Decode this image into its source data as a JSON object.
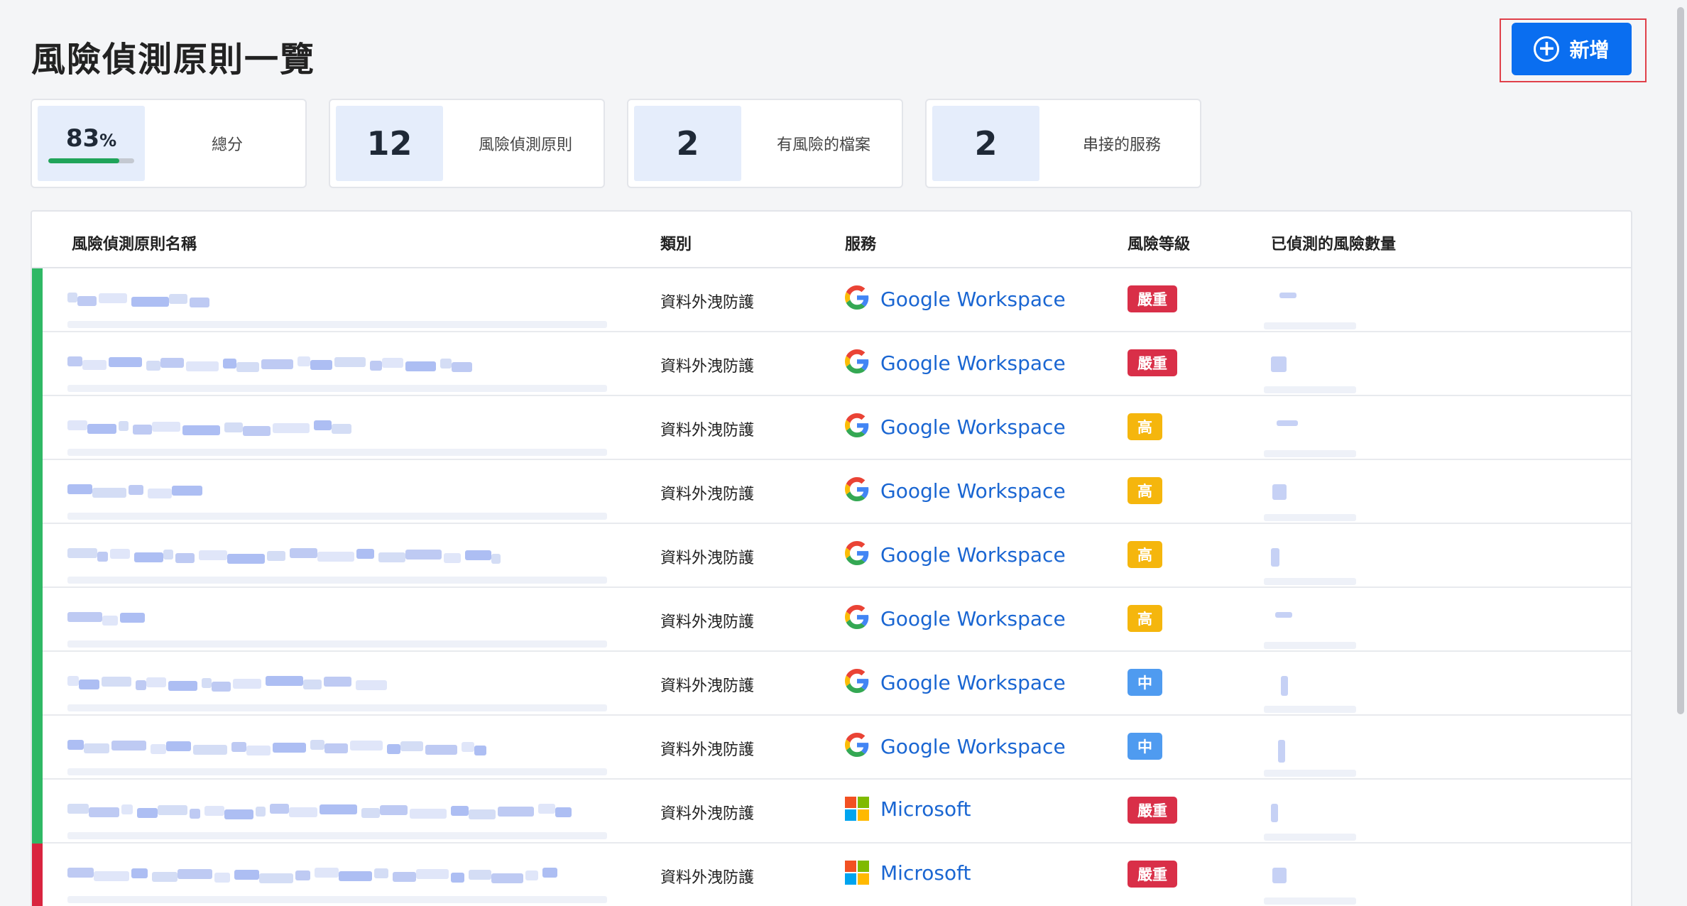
{
  "header": {
    "title": "風險偵測原則一覽",
    "add_label": "新增"
  },
  "stats": [
    {
      "value": "83",
      "unit": "%",
      "label": "總分",
      "progress": 0.83
    },
    {
      "value": "12",
      "label": "風險偵測原則"
    },
    {
      "value": "2",
      "label": "有風險的檔案"
    },
    {
      "value": "2",
      "label": "串接的服務"
    }
  ],
  "table": {
    "columns": [
      "風險偵測原則名稱",
      "類別",
      "服務",
      "風險等級",
      "已偵測的風險數量"
    ],
    "rows": [
      {
        "category": "資料外洩防護",
        "service": "Google Workspace",
        "service_icon": "google-icon",
        "risk": "嚴重",
        "risk_color": "#d92f48",
        "status_color": "#2fb865"
      },
      {
        "category": "資料外洩防護",
        "service": "Google Workspace",
        "service_icon": "google-icon",
        "risk": "嚴重",
        "risk_color": "#d92f48",
        "status_color": "#2fb865"
      },
      {
        "category": "資料外洩防護",
        "service": "Google Workspace",
        "service_icon": "google-icon",
        "risk": "高",
        "risk_color": "#f5b60d",
        "status_color": "#2fb865"
      },
      {
        "category": "資料外洩防護",
        "service": "Google Workspace",
        "service_icon": "google-icon",
        "risk": "高",
        "risk_color": "#f5b60d",
        "status_color": "#2fb865"
      },
      {
        "category": "資料外洩防護",
        "service": "Google Workspace",
        "service_icon": "google-icon",
        "risk": "高",
        "risk_color": "#f5b60d",
        "status_color": "#2fb865"
      },
      {
        "category": "資料外洩防護",
        "service": "Google Workspace",
        "service_icon": "google-icon",
        "risk": "高",
        "risk_color": "#f5b60d",
        "status_color": "#2fb865"
      },
      {
        "category": "資料外洩防護",
        "service": "Google Workspace",
        "service_icon": "google-icon",
        "risk": "中",
        "risk_color": "#4f9bf0",
        "status_color": "#2fb865"
      },
      {
        "category": "資料外洩防護",
        "service": "Google Workspace",
        "service_icon": "google-icon",
        "risk": "中",
        "risk_color": "#4f9bf0",
        "status_color": "#2fb865"
      },
      {
        "category": "資料外洩防護",
        "service": "Microsoft",
        "service_icon": "microsoft-icon",
        "risk": "嚴重",
        "risk_color": "#d92f48",
        "status_color": "#2fb865"
      },
      {
        "category": "資料外洩防護",
        "service": "Microsoft",
        "service_icon": "microsoft-icon",
        "risk": "嚴重",
        "risk_color": "#d92f48",
        "status_color": "#d9243f"
      }
    ]
  },
  "colors": {
    "accent": "#0a6ef0",
    "link": "#1a66d2",
    "stat_box": "#e5edfb"
  }
}
